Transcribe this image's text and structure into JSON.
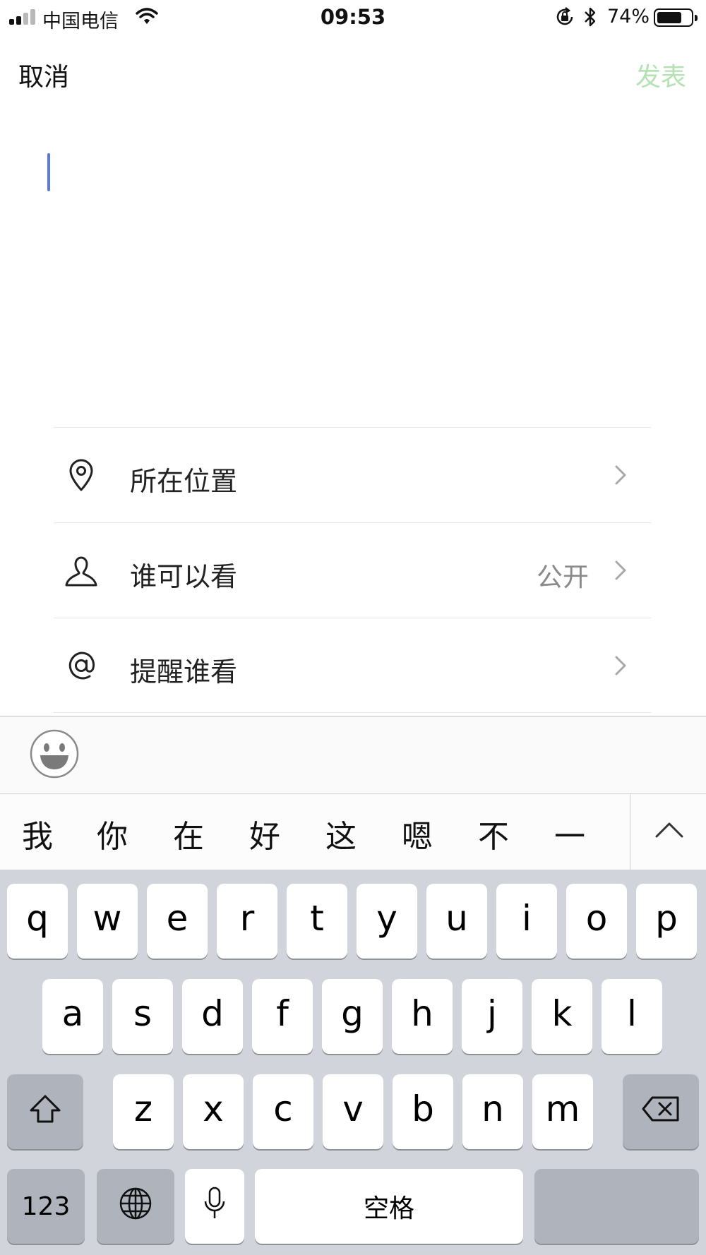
{
  "status_bar": {
    "carrier": "中国电信",
    "time": "09:53",
    "battery_percent": "74%",
    "battery_level": 0.74,
    "signal_bars_active": 2,
    "signal_bars_total": 4
  },
  "nav": {
    "cancel_label": "取消",
    "publish_label": "发表",
    "publish_color": "#b5e2b2"
  },
  "options": [
    {
      "icon": "location-pin-icon",
      "label": "所在位置",
      "value": ""
    },
    {
      "icon": "person-icon",
      "label": "谁可以看",
      "value": "公开"
    },
    {
      "icon": "at-sign-icon",
      "label": "提醒谁看",
      "value": ""
    }
  ],
  "emoji_bar": {
    "icon": "emoji-smile-icon"
  },
  "candidates": [
    "我",
    "你",
    "在",
    "好",
    "这",
    "嗯",
    "不",
    "一"
  ],
  "keyboard": {
    "row1": [
      "q",
      "w",
      "e",
      "r",
      "t",
      "y",
      "u",
      "i",
      "o",
      "p"
    ],
    "row2": [
      "a",
      "s",
      "d",
      "f",
      "g",
      "h",
      "j",
      "k",
      "l"
    ],
    "row3": [
      "z",
      "x",
      "c",
      "v",
      "b",
      "n",
      "m"
    ],
    "numbers_label": "123",
    "space_label": "空格",
    "icons": {
      "shift": "shift-arrow-icon",
      "delete": "backspace-icon",
      "globe": "globe-icon",
      "mic": "microphone-icon"
    }
  },
  "colors": {
    "caret": "#5a78e8",
    "keyboard_bg": "#d1d4da",
    "key_dark": "#aeb3bc"
  }
}
